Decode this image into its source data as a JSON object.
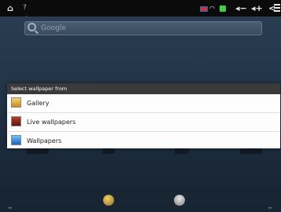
{
  "statusbar": {
    "icons": [
      "home-icon",
      "debug-icon",
      "flag-icon",
      "wifi-icon",
      "lock-icon",
      "volume-down-icon",
      "volume-up-icon",
      "back-icon",
      "menu-icon"
    ],
    "home_glyph": "⌂",
    "debug_glyph": "? ⁂",
    "wifi_glyph": "◠",
    "volume_down_glyph": "◂−",
    "volume_up_glyph": "◂+",
    "back_glyph": "<"
  },
  "search": {
    "placeholder": "Google"
  },
  "dialog": {
    "title": "Select wallpaper from",
    "items": [
      {
        "label": "Gallery",
        "icon": "gallery-icon"
      },
      {
        "label": "Live wallpapers",
        "icon": "live-wallpapers-icon"
      },
      {
        "label": "Wallpapers",
        "icon": "wallpapers-icon"
      }
    ]
  },
  "colors": {
    "dialog_title_bg": "#3a3a3a",
    "dialog_bg": "#fdfdfd",
    "statusbar_bg": "#0b0b0b"
  }
}
